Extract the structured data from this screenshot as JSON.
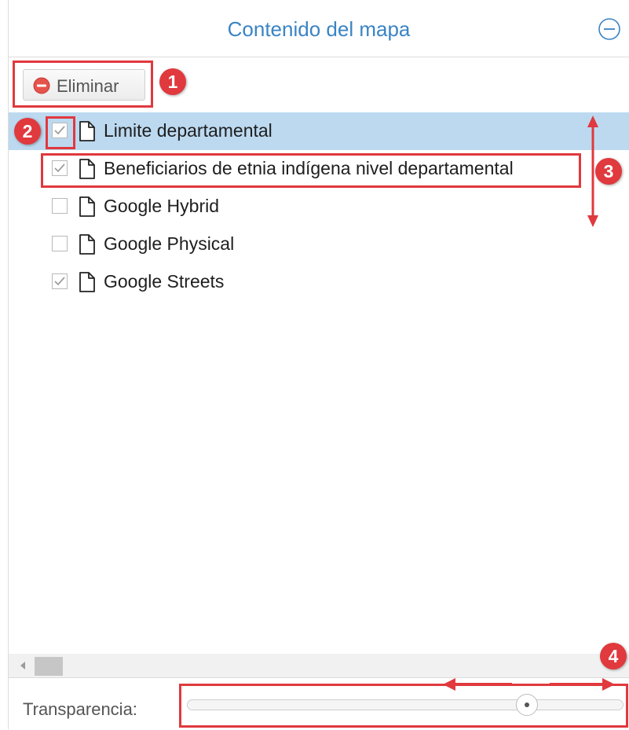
{
  "panel": {
    "title": "Contenido del mapa",
    "collapse_icon": "minus-circle-icon"
  },
  "toolbar": {
    "remove_label": "Eliminar",
    "remove_icon": "minus-circle-icon"
  },
  "layers": [
    {
      "label": "Limite departamental",
      "checked": true,
      "selected": true,
      "icon": "document-icon"
    },
    {
      "label": "Beneficiarios de etnia indígena nivel departamental",
      "checked": true,
      "selected": false,
      "icon": "document-icon"
    },
    {
      "label": "Google Hybrid",
      "checked": false,
      "selected": false,
      "icon": "document-icon"
    },
    {
      "label": "Google Physical",
      "checked": false,
      "selected": false,
      "icon": "document-icon"
    },
    {
      "label": "Google Streets",
      "checked": true,
      "selected": false,
      "icon": "document-icon"
    }
  ],
  "footer": {
    "transparency_label": "Transparencia:",
    "transparency_value": 0.78
  },
  "annotations": {
    "badges": [
      "1",
      "2",
      "3",
      "4"
    ],
    "color": "#e0393e"
  },
  "colors": {
    "accent": "#3a84c4",
    "selected_row": "#bcd9f0",
    "remove_icon": "#e5534b"
  }
}
